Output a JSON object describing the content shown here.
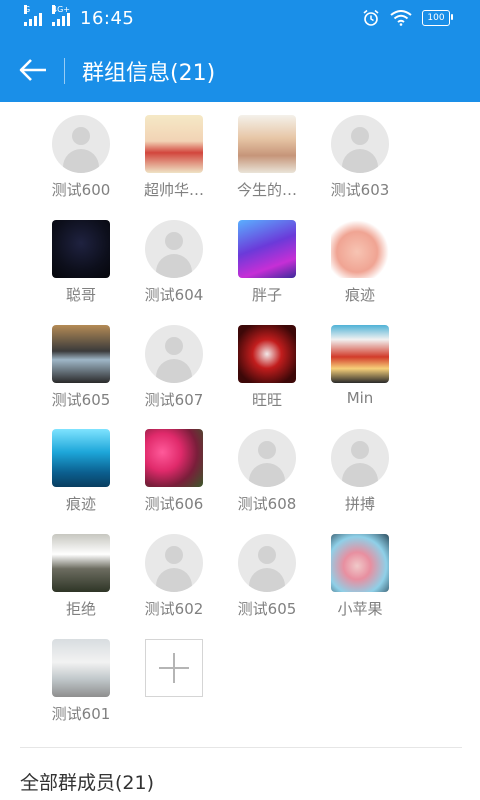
{
  "status": {
    "network_left": "G",
    "network_right": "4G+",
    "time": "16:45",
    "battery": "100"
  },
  "header": {
    "title": "群组信息(21)"
  },
  "members": [
    {
      "name": "测试600",
      "avatar": "default"
    },
    {
      "name": "超帅华…",
      "avatar": "cartoon-boy"
    },
    {
      "name": "今生的…",
      "avatar": "hands-photo"
    },
    {
      "name": "测试603",
      "avatar": "default"
    },
    {
      "name": "聪哥",
      "avatar": "dark-photo"
    },
    {
      "name": "测试604",
      "avatar": "default"
    },
    {
      "name": "胖子",
      "avatar": "purple-phone"
    },
    {
      "name": "痕迹",
      "avatar": "pig-cartoon"
    },
    {
      "name": "测试605",
      "avatar": "laptop-photo"
    },
    {
      "name": "测试607",
      "avatar": "default"
    },
    {
      "name": "旺旺",
      "avatar": "red-figure"
    },
    {
      "name": "Min",
      "avatar": "sunset-banner"
    },
    {
      "name": "痕迹",
      "avatar": "fish-underwater"
    },
    {
      "name": "测试606",
      "avatar": "flowers"
    },
    {
      "name": "测试608",
      "avatar": "default"
    },
    {
      "name": "拼搏",
      "avatar": "default"
    },
    {
      "name": "拒绝",
      "avatar": "waterfall"
    },
    {
      "name": "测试602",
      "avatar": "default"
    },
    {
      "name": "测试605",
      "avatar": "default"
    },
    {
      "name": "小苹果",
      "avatar": "girl-photo"
    },
    {
      "name": "测试601",
      "avatar": "boy-photo"
    }
  ],
  "footer": {
    "all_members_label": "全部群成员(21)"
  },
  "colors": {
    "primary": "#1a8fe8",
    "name_gray": "#808080"
  }
}
